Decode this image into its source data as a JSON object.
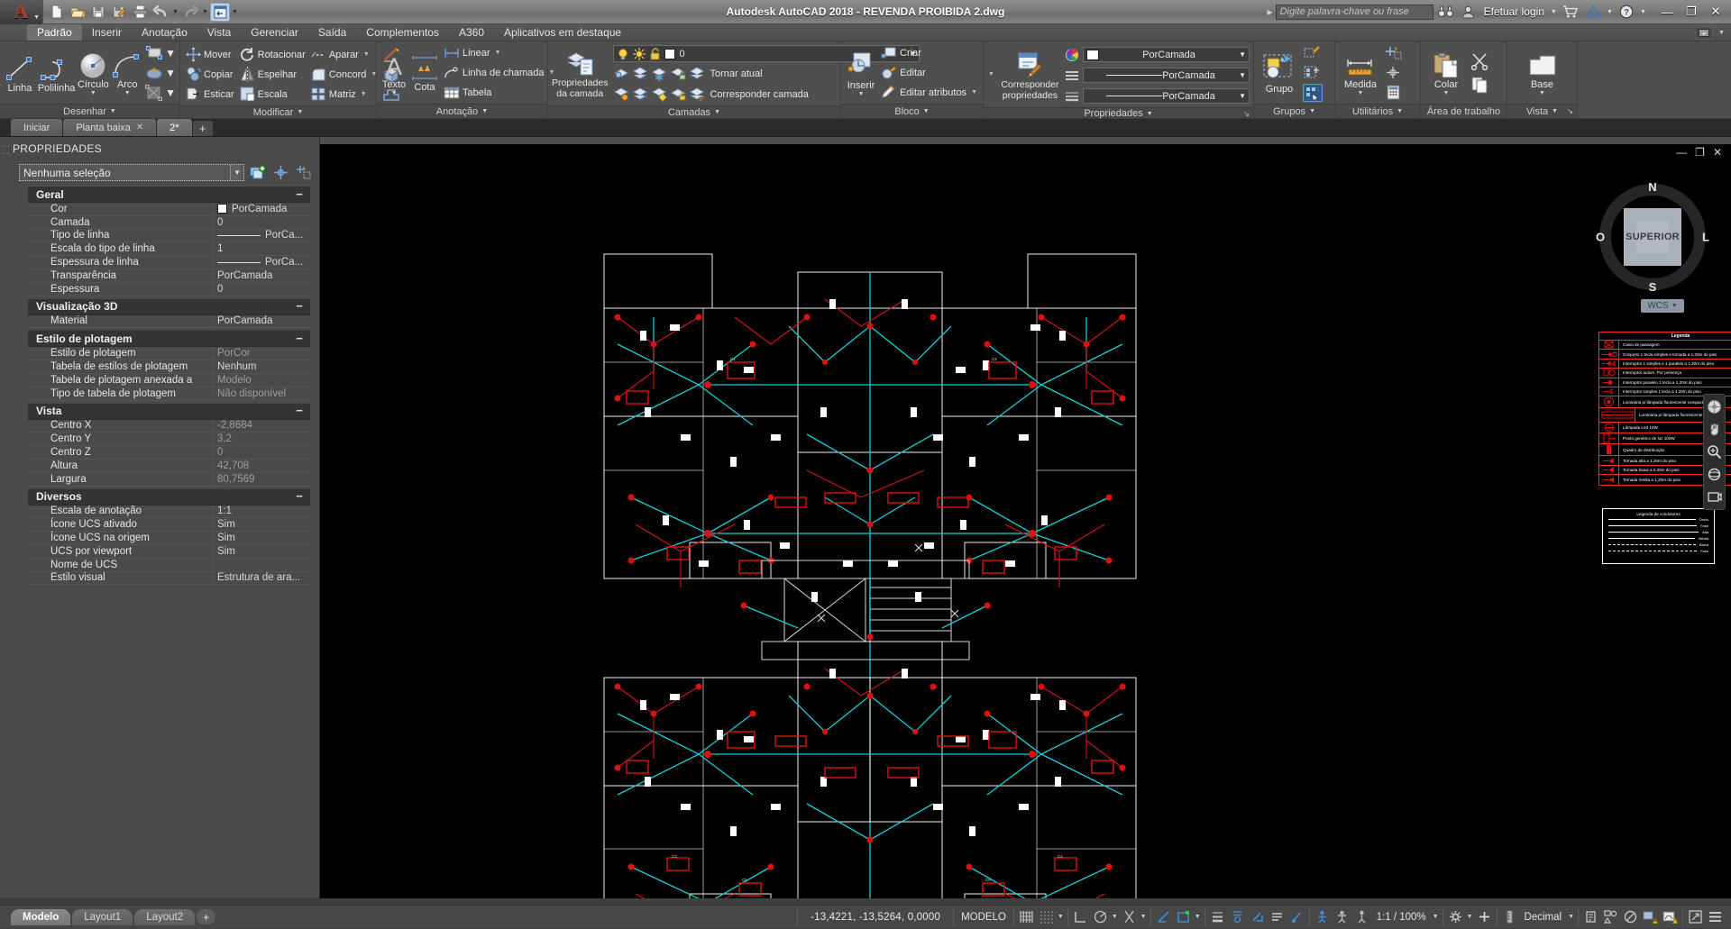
{
  "titlebar": {
    "app_logo": "autocad-a-logo",
    "title": "Autodesk AutoCAD 2018 - REVENDA PROIBIDA   2.dwg",
    "search_placeholder": "Digite palavra-chave ou frase",
    "login_label": "Efetuar login",
    "quick_access": [
      {
        "name": "new-icon",
        "label": "Novo"
      },
      {
        "name": "open-icon",
        "label": "Abrir"
      },
      {
        "name": "save-icon",
        "label": "Salvar"
      },
      {
        "name": "saveas-icon",
        "label": "Salvar como"
      },
      {
        "name": "plot-icon",
        "label": "Plotar"
      },
      {
        "name": "undo-icon",
        "label": "Desfazer"
      },
      {
        "name": "redo-icon",
        "label": "Refazer"
      },
      {
        "name": "workspace-icon",
        "label": "Área de trabalho"
      }
    ],
    "window_buttons": [
      "minimize",
      "restore",
      "close"
    ]
  },
  "ribbon_tabs": [
    {
      "label": "Padrão",
      "selected": true
    },
    {
      "label": "Inserir",
      "selected": false
    },
    {
      "label": "Anotação",
      "selected": false
    },
    {
      "label": "Vista",
      "selected": false
    },
    {
      "label": "Gerenciar",
      "selected": false
    },
    {
      "label": "Saída",
      "selected": false
    },
    {
      "label": "Complementos",
      "selected": false
    },
    {
      "label": "A360",
      "selected": false
    },
    {
      "label": "Aplicativos em destaque",
      "selected": false
    }
  ],
  "ribbon": {
    "desenhar": {
      "title": "Desenhar",
      "big": [
        {
          "label": "Linha",
          "icon": "line-icon",
          "dropdown": false
        },
        {
          "label": "Polilinha",
          "icon": "polyline-icon",
          "dropdown": false
        },
        {
          "label": "Círculo",
          "icon": "circle-icon",
          "dropdown": true
        },
        {
          "label": "Arco",
          "icon": "arc-icon",
          "dropdown": true
        }
      ],
      "small": [
        {
          "icon": "rectangle-icon",
          "dropdown": true
        },
        {
          "icon": "hatch-icon",
          "dropdown": true
        },
        {
          "icon": "gradient-icon",
          "dropdown": true
        }
      ]
    },
    "modificar": {
      "title": "Modificar",
      "items": [
        {
          "label": "Mover",
          "icon": "move-icon"
        },
        {
          "label": "Copiar",
          "icon": "copy-icon"
        },
        {
          "label": "Esticar",
          "icon": "stretch-icon"
        },
        {
          "label": "Rotacionar",
          "icon": "rotate-icon"
        },
        {
          "label": "Espelhar",
          "icon": "mirror-icon"
        },
        {
          "label": "Escala",
          "icon": "scale-icon"
        },
        {
          "label": "Aparar",
          "icon": "trim-icon",
          "dropdown": true
        },
        {
          "label": "Concord",
          "icon": "fillet-icon",
          "dropdown": true
        },
        {
          "label": "Matriz",
          "icon": "array-icon",
          "dropdown": true
        }
      ],
      "extra_icons": [
        {
          "icon": "explode-icon"
        },
        {
          "icon": "3d-box-icon"
        },
        {
          "icon": "solid-edit-icon"
        }
      ]
    },
    "anotacao": {
      "title": "Anotação",
      "big": [
        {
          "label": "Texto",
          "icon": "text-icon",
          "dropdown": true
        },
        {
          "label": "Cota",
          "icon": "dimension-icon",
          "dropdown": false
        }
      ],
      "small": [
        {
          "label": "Linear",
          "icon": "linear-dim-icon",
          "dropdown": true
        },
        {
          "label": "Linha de chamada",
          "icon": "leader-icon",
          "dropdown": true
        },
        {
          "label": "Tabela",
          "icon": "table-icon",
          "dropdown": false
        }
      ]
    },
    "camadas": {
      "title": "Camadas",
      "big_label": "Propriedades\nda camada",
      "big_label_l1": "Propriedades",
      "big_label_l2": "da camada",
      "current_layer": "0",
      "layer_color": "#ffffff",
      "row1": [
        {
          "icon": "layer-isolate-icon"
        },
        {
          "icon": "layer-off-icon"
        },
        {
          "icon": "layer-freeze-icon"
        },
        {
          "icon": "layer-lock-icon"
        },
        {
          "icon": "layer-make-current-icon",
          "label": "Tornar atual"
        }
      ],
      "row2": [
        {
          "icon": "layer-unisolate-icon"
        },
        {
          "icon": "layer-on-icon"
        },
        {
          "icon": "layer-thaw-icon"
        },
        {
          "icon": "layer-unlock-icon"
        },
        {
          "icon": "layer-match-icon",
          "label": "Corresponder camada"
        }
      ]
    },
    "bloco": {
      "title": "Bloco",
      "big": {
        "label": "Inserir",
        "icon": "insert-block-icon",
        "dropdown": true
      },
      "items": [
        {
          "label": "Criar",
          "icon": "create-block-icon"
        },
        {
          "label": "Editar",
          "icon": "edit-block-icon"
        },
        {
          "label": "Editar atributos",
          "icon": "edit-attributes-icon",
          "dropdown": true
        }
      ]
    },
    "propriedades": {
      "title": "Propriedades",
      "big_l1": "Corresponder",
      "big_l2": "propriedades",
      "big_icon": "match-properties-icon",
      "combos": [
        {
          "icon": "color-wheel-icon",
          "value": "PorCamada",
          "swatch": "#ffffff"
        },
        {
          "icon": "linetype-icon",
          "value": "PorCamada"
        },
        {
          "icon": "lineweight-icon",
          "value": "PorCamada"
        }
      ]
    },
    "grupos": {
      "title": "Grupos",
      "big": {
        "label": "Grupo",
        "icon": "group-icon"
      },
      "small": [
        {
          "icon": "edit-group-icon"
        },
        {
          "icon": "ungroup-icon"
        },
        {
          "icon": "group-selection-icon",
          "active": true
        }
      ]
    },
    "utilitarios": {
      "title": "Utilitários",
      "big": {
        "label": "Medida",
        "icon": "measure-icon",
        "dropdown": true
      },
      "small": [
        {
          "icon": "quick-select-icon"
        },
        {
          "icon": "point-id-icon"
        },
        {
          "icon": "calculator-icon"
        }
      ]
    },
    "area_trabalho": {
      "title": "Área de trabalho",
      "big": {
        "label": "Colar",
        "icon": "paste-icon",
        "dropdown": true
      },
      "small": [
        {
          "icon": "cut-icon"
        },
        {
          "icon": "copy-clip-icon"
        }
      ]
    },
    "vista": {
      "title": "Vista",
      "big": {
        "label": "Base",
        "icon": "base-view-icon",
        "dropdown": true
      }
    }
  },
  "file_tabs": [
    {
      "label": "Iniciar",
      "active": false,
      "closable": false
    },
    {
      "label": "Planta baixa",
      "active": false,
      "closable": true
    },
    {
      "label": "2*",
      "active": true,
      "closable": false
    }
  ],
  "file_tab_add": "+",
  "properties_palette": {
    "title": "PROPRIEDADES",
    "selection": "Nenhuma seleção",
    "toolbar_icons": [
      "quick-select-icon",
      "pick-point-icon",
      "select-objects-icon"
    ],
    "groups": [
      {
        "name": "Geral",
        "rows": [
          {
            "key": "Cor",
            "value": "PorCamada",
            "type": "color"
          },
          {
            "key": "Camada",
            "value": "0",
            "type": "text"
          },
          {
            "key": "Tipo de linha",
            "value": "PorCa...",
            "type": "line"
          },
          {
            "key": "Escala do tipo de linha",
            "value": "1",
            "type": "text"
          },
          {
            "key": "Espessura de linha",
            "value": "PorCa...",
            "type": "line"
          },
          {
            "key": "Transparência",
            "value": "PorCamada",
            "type": "text"
          },
          {
            "key": "Espessura",
            "value": "0",
            "type": "text"
          }
        ]
      },
      {
        "name": "Visualização 3D",
        "rows": [
          {
            "key": "Material",
            "value": "PorCamada",
            "type": "text"
          }
        ]
      },
      {
        "name": "Estilo de plotagem",
        "rows": [
          {
            "key": "Estilo de plotagem",
            "value": "PorCor",
            "type": "dim"
          },
          {
            "key": "Tabela de estilos de plotagem",
            "value": "Nenhum",
            "type": "text"
          },
          {
            "key": "Tabela de plotagem anexada a",
            "value": "Modelo",
            "type": "dim"
          },
          {
            "key": "Tipo de tabela de plotagem",
            "value": "Não disponível",
            "type": "dim"
          }
        ]
      },
      {
        "name": "Vista",
        "rows": [
          {
            "key": "Centro X",
            "value": "-2,8684",
            "type": "dim"
          },
          {
            "key": "Centro Y",
            "value": "3,2",
            "type": "dim"
          },
          {
            "key": "Centro Z",
            "value": "0",
            "type": "dim"
          },
          {
            "key": "Altura",
            "value": "42,708",
            "type": "dim"
          },
          {
            "key": "Largura",
            "value": "80,7569",
            "type": "dim"
          }
        ]
      },
      {
        "name": "Diversos",
        "rows": [
          {
            "key": "Escala de anotação",
            "value": "1:1",
            "type": "text"
          },
          {
            "key": "Ícone UCS ativado",
            "value": "Sim",
            "type": "text"
          },
          {
            "key": "Ícone UCS na origem",
            "value": "Sim",
            "type": "text"
          },
          {
            "key": "UCS por viewport",
            "value": "Sim",
            "type": "text"
          },
          {
            "key": "Nome de UCS",
            "value": "",
            "type": "text"
          },
          {
            "key": "Estilo visual",
            "value": "Estrutura de ara...",
            "type": "text"
          }
        ]
      }
    ]
  },
  "canvas": {
    "navcube": {
      "face_label": "SUPERIOR",
      "north": "N",
      "south": "S",
      "west": "O",
      "east": "L",
      "wcs_label": "WCS"
    },
    "viewport_buttons": [
      "minimize",
      "restore",
      "close"
    ],
    "legend": {
      "title": "Legenda",
      "rows": [
        {
          "symbol": "caixa-passagem",
          "text": "Caixa de passagem"
        },
        {
          "symbol": "conjunto-interruptor-tomada",
          "text": "Conjunto 1 tecla simples e tomada a 1,20m do piso"
        },
        {
          "symbol": "interruptor-simples-paralelo",
          "text": "Interruptor 1 simples e 1 paralelo a 1,20m do piso"
        },
        {
          "symbol": "interruptor-presenca",
          "text": "Interruptor autom. Por presença"
        },
        {
          "symbol": "interruptor-paralelo-1tecla",
          "text": "Interruptor paralelo 1 tecla a 1,20m do piso"
        },
        {
          "symbol": "interruptor-simples-1tecla",
          "text": "Interruptor simples 1 tecla a 1,20m do piso"
        },
        {
          "symbol": "luminaria-fluorescente-compacta",
          "text": "Luminária p/ lâmpada fluorescente compacta"
        },
        {
          "symbol": "luminaria-fluorescente-tubular",
          "text": "Luminária p/ lâmpada fluorescente tubular"
        },
        {
          "symbol": "lampada-led",
          "text": "Lâmpada Led 10W"
        },
        {
          "symbol": "ponto-generico-luz",
          "text": "Ponto genérico de luz 100W"
        },
        {
          "symbol": "quadro-distribuicao",
          "text": "Quadro de distribuição"
        },
        {
          "symbol": "tomada-alta",
          "text": "Tomada alta a 1,20m do piso"
        },
        {
          "symbol": "tomada-baixa",
          "text": "Tomada baixa a 0,30m do piso"
        },
        {
          "symbol": "tomada-media",
          "text": "Tomada média a 1,20m do piso"
        }
      ]
    },
    "legend2": {
      "title": "Legenda de condutores",
      "rows": [
        {
          "label": "Óxido"
        },
        {
          "label": "Fase"
        },
        {
          "label": "Alta"
        },
        {
          "label": "Média"
        },
        {
          "label": "Baixa"
        },
        {
          "label": "Fase"
        }
      ]
    }
  },
  "statusbar": {
    "model_tabs": [
      {
        "label": "Modelo",
        "active": true
      },
      {
        "label": "Layout1",
        "active": false
      },
      {
        "label": "Layout2",
        "active": false
      }
    ],
    "add_layout": "+",
    "coordinates": "-13,4221, -13,5264, 0,0000",
    "space_mode": "MODELO",
    "scale": "1:1 / 100%",
    "units": "Decimal",
    "icons": [
      {
        "name": "grid-display-icon",
        "active": false
      },
      {
        "name": "snap-mode-icon",
        "active": false,
        "dropdown": true
      },
      {
        "name": "ortho-mode-icon",
        "active": false
      },
      {
        "name": "polar-tracking-icon",
        "active": false,
        "dropdown": true
      },
      {
        "name": "object-snap-icon",
        "active": false,
        "dropdown": true
      },
      {
        "name": "osnap-tracking-icon",
        "active": true
      },
      {
        "name": "dynamic-ucs-icon",
        "active": true,
        "dropdown": true
      },
      {
        "name": "lineweight-display-icon",
        "active": false
      },
      {
        "name": "transparency-icon",
        "active": false
      },
      {
        "name": "selection-cycling-icon",
        "active": true
      },
      {
        "name": "annotation-visibility-icon",
        "active": false
      },
      {
        "name": "autoscale-icon",
        "active": false
      },
      {
        "name": "workspace-switch-icon",
        "dropdown": true
      },
      {
        "name": "annotation-monitor-icon"
      },
      {
        "name": "units-icon"
      },
      {
        "name": "quick-properties-icon"
      },
      {
        "name": "isolate-objects-icon"
      },
      {
        "name": "graphics-performance-icon"
      },
      {
        "name": "clean-screen-icon"
      },
      {
        "name": "customization-icon"
      }
    ]
  }
}
